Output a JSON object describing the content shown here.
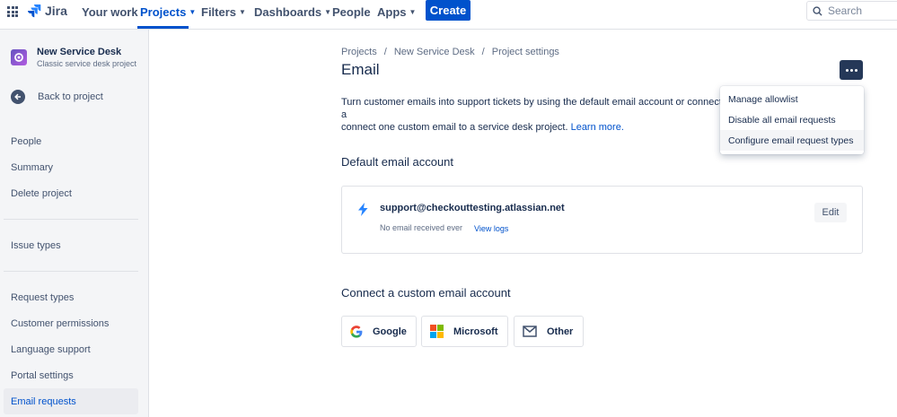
{
  "topnav": {
    "logo_text": "Jira",
    "items": [
      {
        "label": "Your work"
      },
      {
        "label": "Projects",
        "active": true
      },
      {
        "label": "Filters"
      },
      {
        "label": "Dashboards"
      },
      {
        "label": "People"
      },
      {
        "label": "Apps"
      }
    ],
    "create_label": "Create",
    "search_placeholder": "Search"
  },
  "sidebar": {
    "project_name": "New Service Desk",
    "project_type": "Classic service desk project",
    "back_label": "Back to project",
    "items": [
      {
        "label": "People"
      },
      {
        "label": "Summary"
      },
      {
        "label": "Delete project"
      },
      {
        "label": "Issue types"
      },
      {
        "label": "Request types"
      },
      {
        "label": "Customer permissions"
      },
      {
        "label": "Language support"
      },
      {
        "label": "Portal settings"
      },
      {
        "label": "Email requests",
        "selected": true
      }
    ]
  },
  "main": {
    "breadcrumbs": [
      "Projects",
      "New Service Desk",
      "Project settings"
    ],
    "breadcrumb_separator": "/",
    "title": "Email",
    "description_part1": "Turn customer emails into support tickets by using the default email account or connect a",
    "description_part2": "connect one custom email to a service desk project.",
    "learn_more": "Learn more.",
    "default_section_title": "Default email account",
    "default_account": {
      "email": "support@checkouttesting.atlassian.net",
      "status": "No email received ever",
      "view_logs": "View logs",
      "edit_label": "Edit"
    },
    "custom_section_title": "Connect a custom email account",
    "providers": [
      {
        "label": "Google"
      },
      {
        "label": "Microsoft"
      },
      {
        "label": "Other"
      }
    ]
  },
  "dropdown": {
    "items": [
      {
        "label": "Manage allowlist"
      },
      {
        "label": "Disable all email requests"
      },
      {
        "label": "Configure email request types",
        "hovered": true
      }
    ]
  },
  "colors": {
    "accent": "#0052CC",
    "text": "#172B4D",
    "sidebar_bg": "#F4F5F7",
    "more_button_bg": "#253858"
  }
}
